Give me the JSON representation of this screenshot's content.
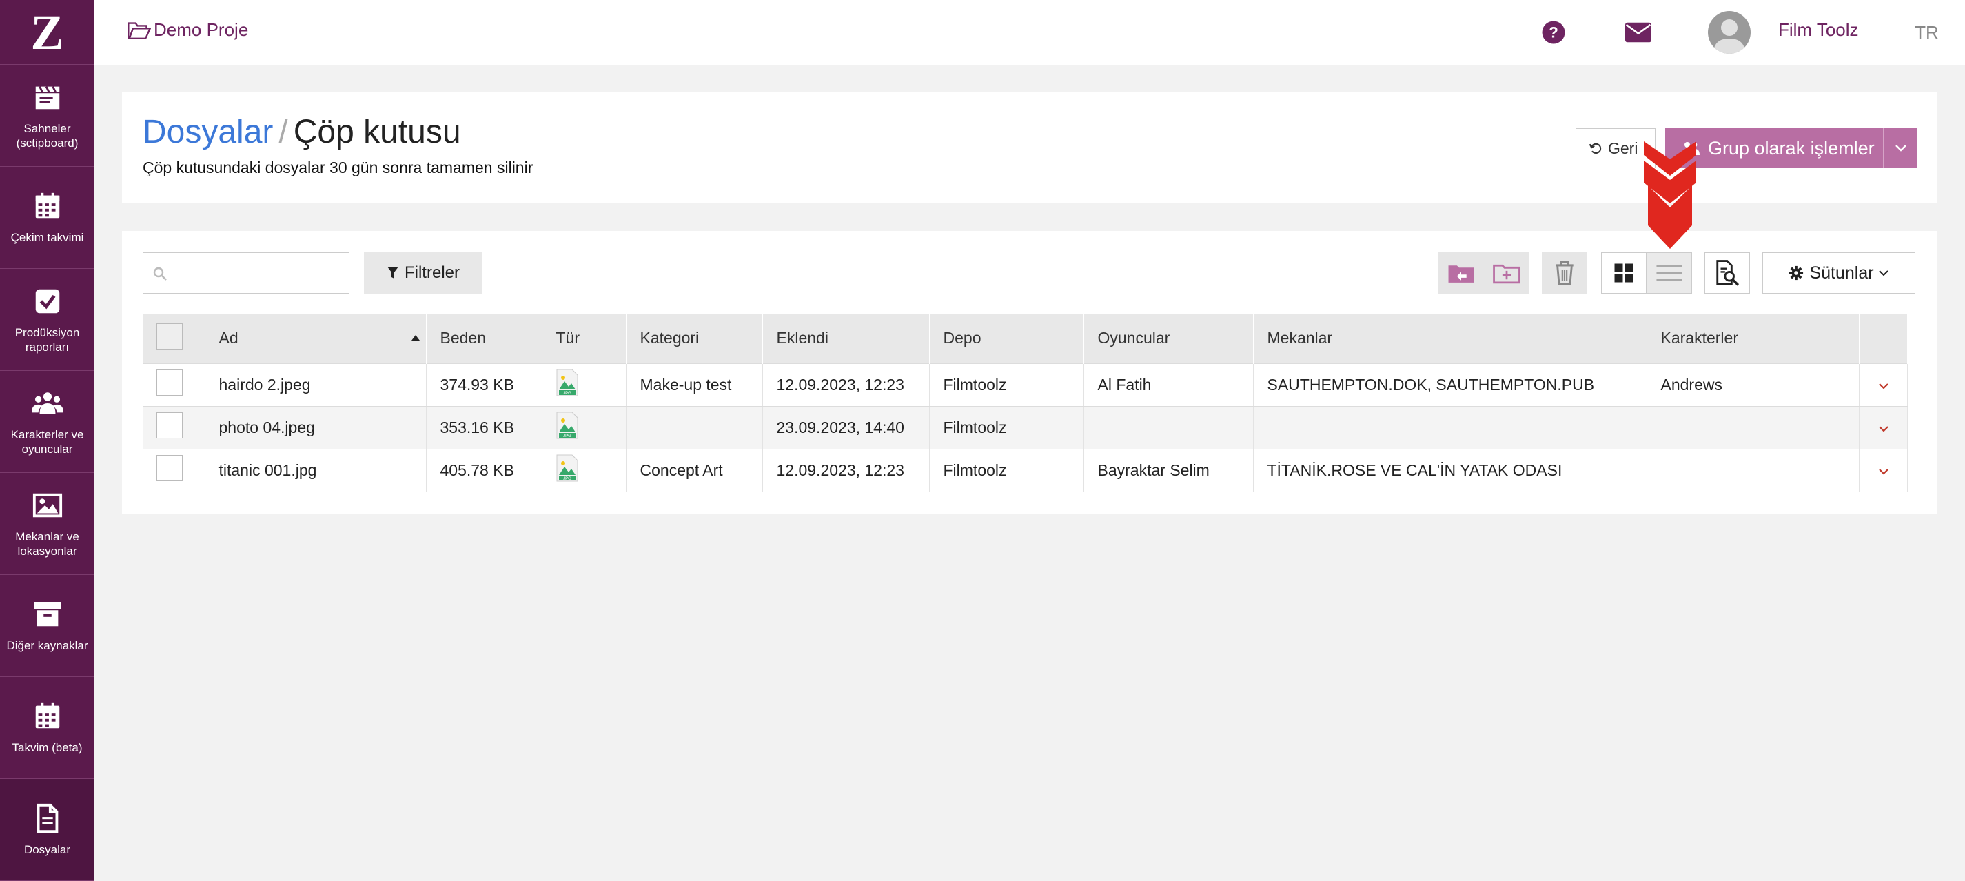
{
  "app": {
    "logo_text": "Z",
    "project": "Demo Proje",
    "user_name": "Film Toolz",
    "language": "TR"
  },
  "sidebar": {
    "items": [
      {
        "label": "Sahneler (sctipboard)",
        "icon": "clapperboard-icon"
      },
      {
        "label": "Çekim takvimi",
        "icon": "calendar-icon"
      },
      {
        "label": "Prodüksiyon raporları",
        "icon": "checkbox-icon"
      },
      {
        "label": "Karakterler ve oyuncular",
        "icon": "users-icon"
      },
      {
        "label": "Mekanlar ve lokasyonlar",
        "icon": "image-icon"
      },
      {
        "label": "Diğer kaynaklar",
        "icon": "archive-icon"
      },
      {
        "label": "Takvim (beta)",
        "icon": "calendar-icon"
      },
      {
        "label": "Dosyalar",
        "icon": "file-icon"
      }
    ]
  },
  "header": {
    "breadcrumb": "Dosyalar",
    "separator": "/",
    "title": "Çöp kutusu",
    "subtitle": "Çöp kutusundaki dosyalar 30 gün sonra tamamen silinir",
    "back_label": "Geri",
    "group_label": "Grup olarak işlemler"
  },
  "toolbar": {
    "search_placeholder": "",
    "filters_label": "Filtreler",
    "columns_label": "Sütunlar"
  },
  "table": {
    "columns": [
      "Ad",
      "Beden",
      "Tür",
      "Kategori",
      "Eklendi",
      "Depo",
      "Oyuncular",
      "Mekanlar",
      "Karakterler"
    ],
    "rows": [
      {
        "name": "hairdo 2.jpeg",
        "size": "374.93 KB",
        "type_icon": "jpg-file-icon",
        "category": "Make-up test",
        "added": "12.09.2023, 12:23",
        "storage": "Filmtoolz",
        "actors": "Al Fatih",
        "locations": "SAUTHEMPTON.DOK, SAUTHEMPTON.PUB",
        "characters": "Andrews"
      },
      {
        "name": "photo 04.jpeg",
        "size": "353.16 KB",
        "type_icon": "jpg-file-icon",
        "category": "",
        "added": "23.09.2023, 14:40",
        "storage": "Filmtoolz",
        "actors": "",
        "locations": "",
        "characters": ""
      },
      {
        "name": "titanic 001.jpg",
        "size": "405.78 KB",
        "type_icon": "jpg-file-icon",
        "category": "Concept Art",
        "added": "12.09.2023, 12:23",
        "storage": "Filmtoolz",
        "actors": "Bayraktar Selim",
        "locations": "TİTANİK.ROSE VE CAL'İN YATAK ODASI",
        "characters": ""
      }
    ]
  },
  "colors": {
    "brand": "#5b1a4c",
    "accent": "#6e2461",
    "link": "#3c78d8",
    "group_button": "#b86ea3",
    "annotation_arrow": "#e0271f"
  }
}
